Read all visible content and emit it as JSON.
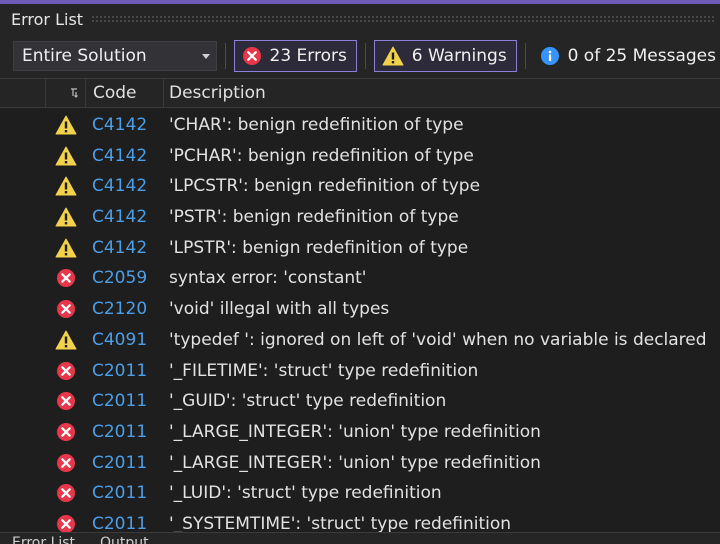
{
  "panel": {
    "title": "Error List"
  },
  "toolbar": {
    "scope_value": "Entire Solution",
    "errors_label": "23 Errors",
    "warnings_label": "6 Warnings",
    "messages_label": "0 of 25 Messages"
  },
  "columns": {
    "code": "Code",
    "description": "Description"
  },
  "rows": [
    {
      "type": "warning",
      "code": "C4142",
      "description": "'CHAR': benign redefinition of type"
    },
    {
      "type": "warning",
      "code": "C4142",
      "description": "'PCHAR': benign redefinition of type"
    },
    {
      "type": "warning",
      "code": "C4142",
      "description": "'LPCSTR': benign redefinition of type"
    },
    {
      "type": "warning",
      "code": "C4142",
      "description": "'PSTR': benign redefinition of type"
    },
    {
      "type": "warning",
      "code": "C4142",
      "description": "'LPSTR': benign redefinition of type"
    },
    {
      "type": "error",
      "code": "C2059",
      "description": "syntax error: 'constant'"
    },
    {
      "type": "error",
      "code": "C2120",
      "description": "'void' illegal with all types"
    },
    {
      "type": "warning",
      "code": "C4091",
      "description": "'typedef ': ignored on left of 'void' when no variable is declared"
    },
    {
      "type": "error",
      "code": "C2011",
      "description": "'_FILETIME': 'struct' type redefinition"
    },
    {
      "type": "error",
      "code": "C2011",
      "description": "'_GUID': 'struct' type redefinition"
    },
    {
      "type": "error",
      "code": "C2011",
      "description": "'_LARGE_INTEGER': 'union' type redefinition"
    },
    {
      "type": "error",
      "code": "C2011",
      "description": "'_LARGE_INTEGER': 'union' type redefinition"
    },
    {
      "type": "error",
      "code": "C2011",
      "description": "'_LUID': 'struct' type redefinition"
    },
    {
      "type": "error",
      "code": "C2011",
      "description": "'_SYSTEMTIME': 'struct' type redefinition"
    }
  ],
  "bottom_tabs": [
    "Error List",
    "Output"
  ],
  "icons": {
    "error": "error-icon",
    "warning": "warning-icon",
    "info": "info-icon",
    "dropdown": "chevron-down-icon",
    "sort": "sort-icon"
  },
  "colors": {
    "accent": "#6e5bb8",
    "error": "#e8374a",
    "warning": "#f2d24a",
    "info": "#3794ff",
    "code_link": "#4a9fe8"
  }
}
